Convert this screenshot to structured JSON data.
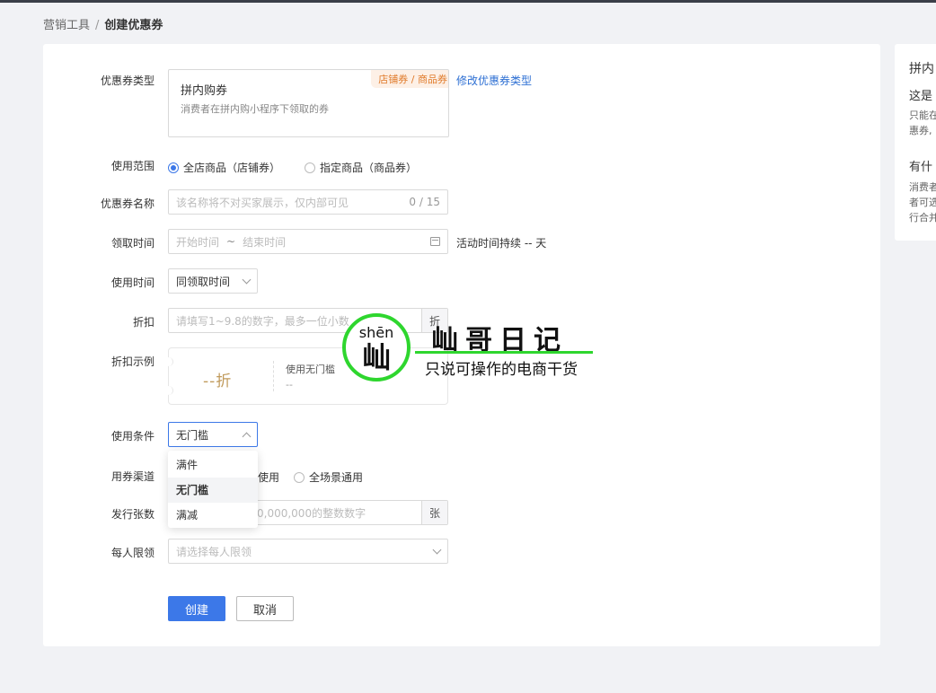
{
  "breadcrumb": {
    "parent": "营销工具",
    "separator": "/",
    "current": "创建优惠券"
  },
  "form": {
    "coupon_type": {
      "label": "优惠券类型",
      "name": "拼内购券",
      "desc": "消费者在拼内购小程序下领取的券",
      "tag": "店铺券 / 商品券",
      "change_link": "修改优惠券类型"
    },
    "scope": {
      "label": "使用范围",
      "options": [
        {
          "text": "全店商品（店铺券）",
          "selected": true
        },
        {
          "text": "指定商品（商品券）",
          "selected": false
        }
      ]
    },
    "coupon_name": {
      "label": "优惠券名称",
      "placeholder": "该名称将不对买家展示，仅内部可见",
      "counter": "0 / 15"
    },
    "claim_time": {
      "label": "领取时间",
      "start_placeholder": "开始时间",
      "range_sep": "~",
      "end_placeholder": "结束时间",
      "duration_text": "活动时间持续 -- 天"
    },
    "use_time": {
      "label": "使用时间",
      "value": "同领取时间"
    },
    "discount": {
      "label": "折扣",
      "placeholder": "请填写1~9.8的数字，最多一位小数",
      "suffix": "折"
    },
    "discount_example": {
      "label": "折扣示例",
      "value": "--折",
      "condition": "使用无门槛",
      "condition_desc": "--"
    },
    "use_condition": {
      "label": "使用条件",
      "value": "无门槛"
    },
    "dropdown": {
      "items": [
        {
          "text": "满件",
          "active": false
        },
        {
          "text": "无门槛",
          "active": true
        },
        {
          "text": "满减",
          "active": false
        }
      ]
    },
    "channel": {
      "label": "用券渠道",
      "options": [
        {
          "text": "使用",
          "selected": false
        },
        {
          "text": "全场景通用",
          "selected": false
        }
      ]
    },
    "issue_count": {
      "label": "发行张数",
      "placeholder": "0,000,000的整数数字",
      "suffix": "张"
    },
    "per_person_limit": {
      "label": "每人限领",
      "placeholder": "请选择每人限领"
    }
  },
  "buttons": {
    "create": "创建",
    "cancel": "取消"
  },
  "side_panel": {
    "title": "拼内",
    "q1": "这是",
    "a1_line1": "只能在",
    "a1_line2": "惠券,",
    "q2": "有什",
    "a2_line1": "消费者",
    "a2_line2": "者可选",
    "a2_line3": "行合并"
  },
  "watermark": {
    "pinyin": "shēn",
    "char": "屾",
    "title": "屾哥日记",
    "subtitle": "只说可操作的电商干货"
  },
  "colors": {
    "primary": "#3c78e8",
    "tag_orange": "#e07b2b",
    "watermark_green": "#2ed62e",
    "link": "#2d6fd3"
  }
}
